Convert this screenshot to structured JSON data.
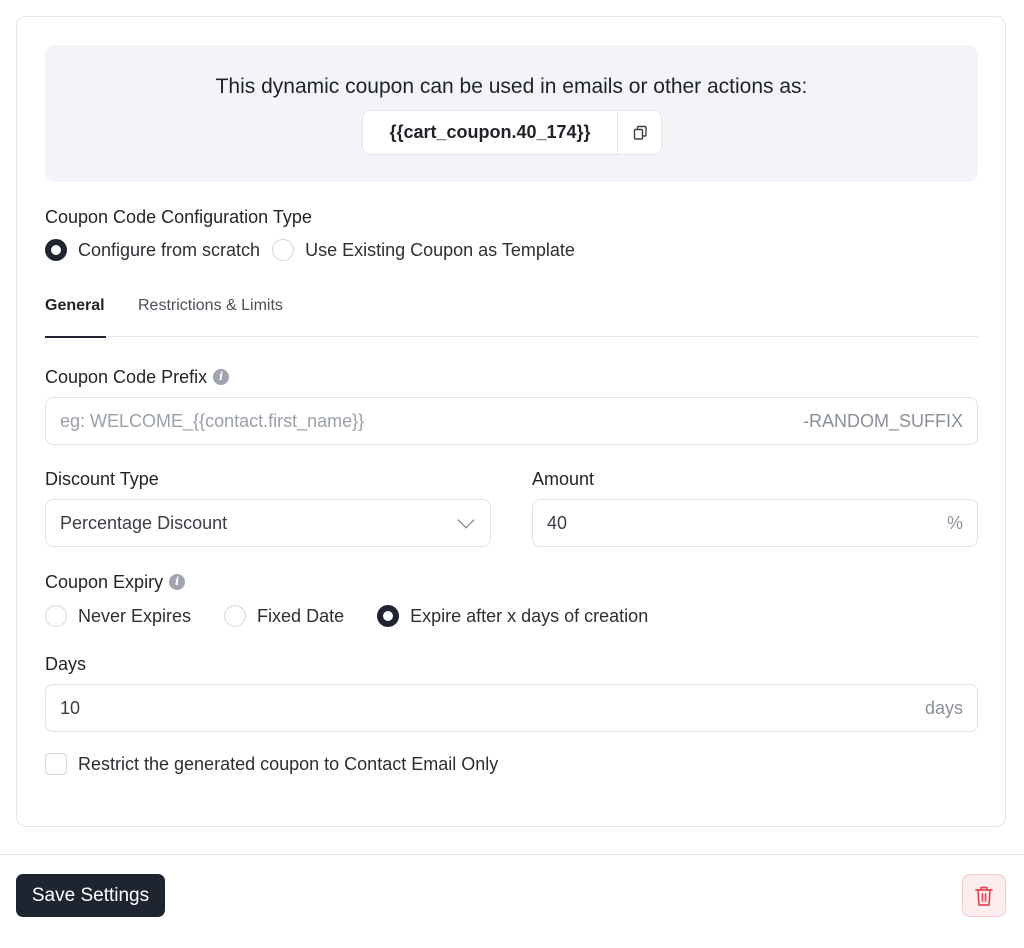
{
  "banner": {
    "title": "This dynamic coupon can be used in emails or other actions as:",
    "code": "{{cart_coupon.40_174}}"
  },
  "config_type": {
    "label": "Coupon Code Configuration Type",
    "options": [
      "Configure from scratch",
      "Use Existing Coupon as Template"
    ],
    "selected": "Configure from scratch"
  },
  "tabs": [
    "General",
    "Restrictions & Limits"
  ],
  "prefix": {
    "label": "Coupon Code Prefix",
    "placeholder": "eg: WELCOME_{{contact.first_name}}",
    "suffix": "-RANDOM_SUFFIX"
  },
  "discount_type": {
    "label": "Discount Type",
    "value": "Percentage Discount"
  },
  "amount": {
    "label": "Amount",
    "value": "40",
    "suffix": "%"
  },
  "expiry": {
    "label": "Coupon Expiry",
    "options": [
      "Never Expires",
      "Fixed Date",
      "Expire after x days of creation"
    ],
    "selected": "Expire after x days of creation"
  },
  "days": {
    "label": "Days",
    "value": "10",
    "suffix": "days"
  },
  "restrict": {
    "label": "Restrict the generated coupon to Contact Email Only",
    "checked": false
  },
  "footer": {
    "save_label": "Save Settings"
  },
  "colors": {
    "primary": "#1e2430",
    "banner_bg": "#f3f4f8",
    "danger": "#e04a5a"
  }
}
